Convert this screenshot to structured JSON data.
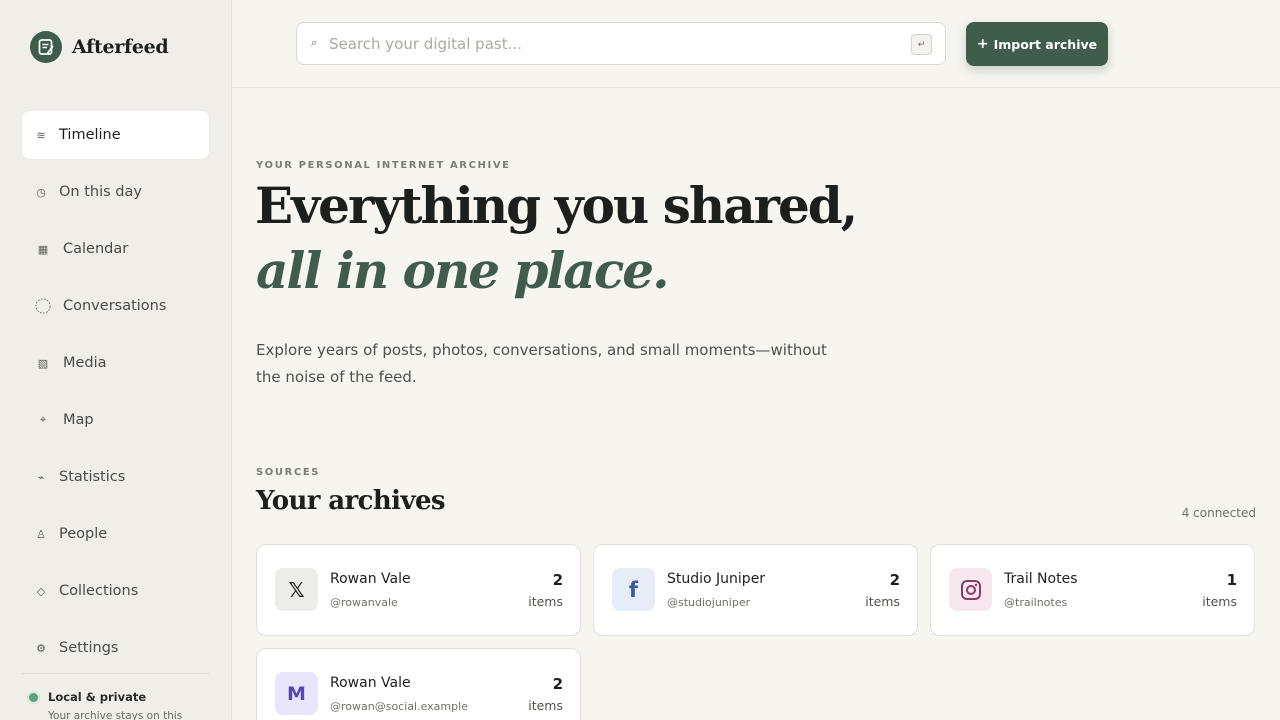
{
  "app": {
    "name": "Afterfeed"
  },
  "sidebar": {
    "items": [
      {
        "label": "Timeline",
        "icon": "timeline-icon",
        "active": true
      },
      {
        "label": "On this day",
        "icon": "clock-icon"
      },
      {
        "label": "Calendar",
        "icon": "calendar-icon"
      },
      {
        "label": "Conversations",
        "icon": "chat-bubble-icon"
      },
      {
        "label": "Media",
        "icon": "media-icon"
      },
      {
        "label": "Map",
        "icon": "map-icon"
      },
      {
        "label": "Statistics",
        "icon": "statistics-icon"
      },
      {
        "label": "People",
        "icon": "people-icon"
      },
      {
        "label": "Collections",
        "icon": "collections-icon"
      },
      {
        "label": "Settings",
        "icon": "gear-icon"
      }
    ],
    "privacy": {
      "title": "Local & private",
      "subtitle": "Your archive stays on this"
    }
  },
  "topbar": {
    "search_placeholder": "Search your digital past...",
    "import_label": "Import archive"
  },
  "hero": {
    "eyebrow": "YOUR PERSONAL INTERNET ARCHIVE",
    "title_line1": "Everything you shared,",
    "title_line2": "all in one place.",
    "description": "Explore years of posts, photos, conversations, and small moments—without the noise of the feed."
  },
  "sources": {
    "eyebrow": "SOURCES",
    "title": "Your archives",
    "connected": "4 connected",
    "cards": [
      {
        "name": "Rowan Vale",
        "handle": "@rowanvale",
        "count": "2",
        "unit": "items",
        "icon": "x-icon",
        "glyph": "𝕏"
      },
      {
        "name": "Studio Juniper",
        "handle": "@studiojuniper",
        "count": "2",
        "unit": "items",
        "icon": "facebook-icon",
        "glyph": "f"
      },
      {
        "name": "Trail Notes",
        "handle": "@trailnotes",
        "count": "1",
        "unit": "items",
        "icon": "instagram-icon",
        "glyph": ""
      },
      {
        "name": "Rowan Vale",
        "handle": "@rowan@social.example",
        "count": "2",
        "unit": "items",
        "icon": "mastodon-icon",
        "glyph": "M"
      }
    ]
  },
  "colors": {
    "accent": "#3f5d4a",
    "sidebar_bg": "#efeee9",
    "page_bg": "#f6f5f0",
    "status_green": "#5fa27a"
  }
}
